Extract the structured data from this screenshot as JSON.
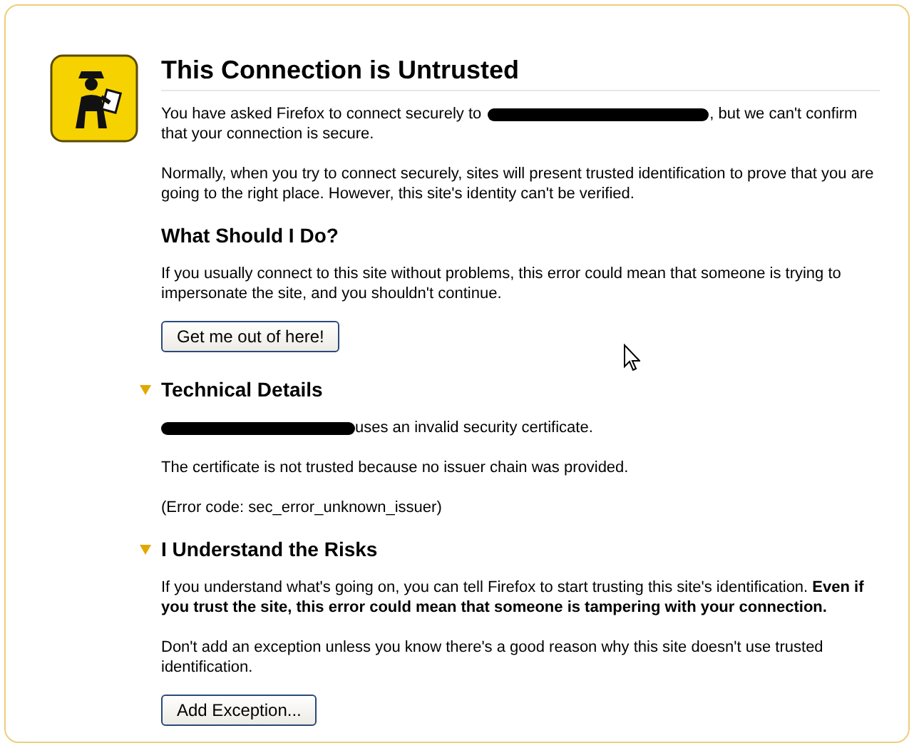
{
  "title": "This Connection is Untrusted",
  "intro": [
    {
      "kind": "redacted",
      "before": "You have asked Firefox to connect securely to",
      "after": ", but we can't confirm",
      "continuation": "that your connection is secure."
    },
    {
      "kind": "text",
      "text": "Normally, when you try to connect securely, sites will present trusted identification to prove that you are going to the right place. However, this site's identity can't be verified."
    }
  ],
  "advice": {
    "heading": "What Should I Do?",
    "content": [
      {
        "kind": "text",
        "text": "If you usually connect to this site without problems, this error could mean that someone is trying to impersonate the site, and you shouldn't continue."
      },
      {
        "kind": "button",
        "label": "Get me out of here!"
      }
    ]
  },
  "sections": [
    {
      "heading": "Technical Details",
      "expanded": true,
      "content": [
        {
          "kind": "redacted",
          "after": "uses an invalid security certificate."
        },
        {
          "kind": "text",
          "text": "The certificate is not trusted because no issuer chain was provided."
        },
        {
          "kind": "text",
          "text": "(Error code: sec_error_unknown_issuer)"
        }
      ]
    },
    {
      "heading": "I Understand the Risks",
      "expanded": true,
      "content": [
        {
          "kind": "text",
          "text": "If you understand what's going on, you can tell Firefox to start trusting this site's identification. **Even if you trust the site, this error could mean that someone is tampering with your connection.**"
        },
        {
          "kind": "text",
          "text": "Don't add an exception unless you know there's a good reason why this site doesn't use trusted identification."
        },
        {
          "kind": "button",
          "label": "Add Exception..."
        }
      ]
    }
  ]
}
